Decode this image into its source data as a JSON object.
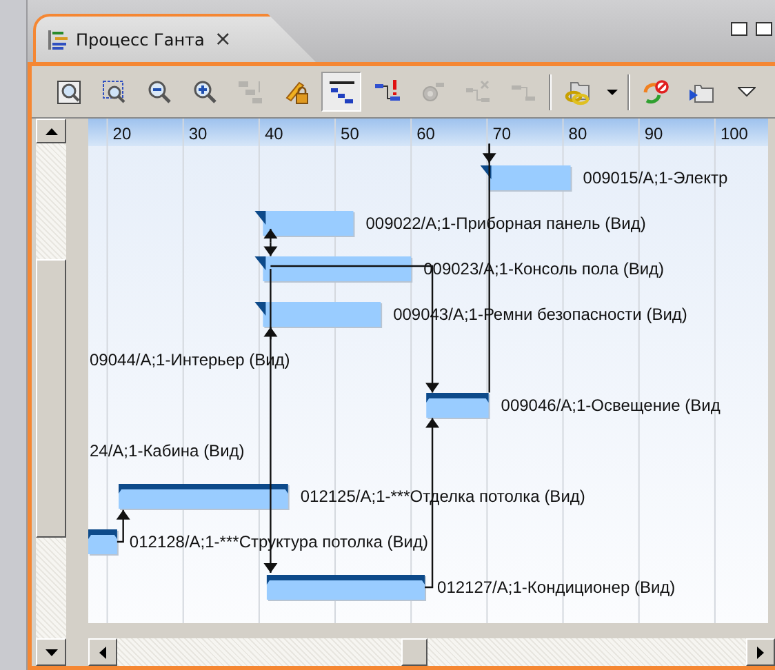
{
  "tab": {
    "title": "Процесс Ганта",
    "close": "×"
  },
  "toolbar": [
    {
      "kind": "zoom-fit",
      "selected": false,
      "disabled": false
    },
    {
      "kind": "zoom-area",
      "selected": false,
      "disabled": false
    },
    {
      "kind": "zoom-out",
      "selected": false,
      "disabled": false
    },
    {
      "kind": "zoom-in",
      "selected": false,
      "disabled": false
    },
    {
      "kind": "tree",
      "selected": false,
      "disabled": true
    },
    {
      "kind": "pencil-lock",
      "selected": false,
      "disabled": false
    },
    {
      "kind": "steps",
      "selected": true,
      "disabled": false
    },
    {
      "kind": "link-alert",
      "selected": false,
      "disabled": false
    },
    {
      "kind": "gear-link",
      "selected": false,
      "disabled": true
    },
    {
      "kind": "link-remove",
      "selected": false,
      "disabled": true
    },
    {
      "kind": "link",
      "selected": false,
      "disabled": true
    },
    {
      "kind": "separator"
    },
    {
      "kind": "chain-folder",
      "selected": false,
      "disabled": false
    },
    {
      "kind": "caret",
      "selected": false,
      "disabled": false
    },
    {
      "kind": "separator"
    },
    {
      "kind": "refresh-stop",
      "selected": false,
      "disabled": false
    },
    {
      "kind": "folder-arrow",
      "selected": false,
      "disabled": false
    },
    {
      "kind": "view-menu",
      "selected": false,
      "disabled": false
    }
  ],
  "gantt": {
    "ticks": [
      "20",
      "30",
      "40",
      "50",
      "60",
      "70",
      "80",
      "90",
      "100"
    ],
    "tasks": [
      {
        "label": "009015/А;1-Электр",
        "kind": "task"
      },
      {
        "label": "009022/А;1-Приборная панель (Вид)",
        "kind": "task"
      },
      {
        "label": "009023/А;1-Консоль пола (Вид)",
        "kind": "task"
      },
      {
        "label": "009043/А;1-Ремни безопасности (Вид)",
        "kind": "task"
      },
      {
        "label": "09044/А;1-Интерьер (Вид)",
        "kind": "offscreen"
      },
      {
        "label": "009046/А;1-Освещение (Вид",
        "kind": "summary"
      },
      {
        "label": "24/А;1-Кабина (Вид)",
        "kind": "offscreen"
      },
      {
        "label": "012125/А;1-***Отделка потолка (Вид)",
        "kind": "summary"
      },
      {
        "label": "012128/А;1-***Структура потолка (Вид)",
        "kind": "summary"
      },
      {
        "label": "012127/А;1-Кондиционер (Вид)",
        "kind": "summary"
      }
    ]
  }
}
